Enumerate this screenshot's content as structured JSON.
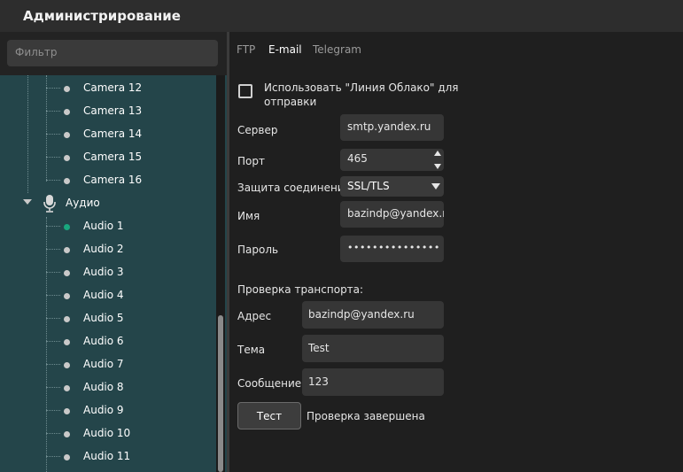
{
  "window": {
    "title": "Администрирование"
  },
  "filter": {
    "placeholder": "Фильтр"
  },
  "tree": {
    "cameras": [
      "Camera 12",
      "Camera 13",
      "Camera 14",
      "Camera 15",
      "Camera 16"
    ],
    "audio_group": "Аудио",
    "audio": [
      "Audio 1",
      "Audio 2",
      "Audio 3",
      "Audio 4",
      "Audio 5",
      "Audio 6",
      "Audio 7",
      "Audio 8",
      "Audio 9",
      "Audio 10",
      "Audio 11"
    ],
    "active_item": "Audio 1",
    "active_color": "#19a77e"
  },
  "tabs": [
    {
      "label": "FTP",
      "active": false
    },
    {
      "label": "E-mail",
      "active": true
    },
    {
      "label": "Telegram",
      "active": false
    }
  ],
  "email": {
    "cloud_checkbox_label": "Использовать \"Линия Облако\" для отправки",
    "cloud_checked": false,
    "server_label": "Сервер",
    "server_value": "smtp.yandex.ru",
    "port_label": "Порт",
    "port_value": "465",
    "security_label": "Защита соединения",
    "security_value": "SSL/TLS",
    "name_label": "Имя",
    "name_value": "bazindp@yandex.ru",
    "password_label": "Пароль",
    "password_value": "•••••••••••••••"
  },
  "transport": {
    "section_title": "Проверка транспорта:",
    "address_label": "Адрес",
    "address_value": "bazindp@yandex.ru",
    "subject_label": "Тема",
    "subject_value": "Test",
    "message_label": "Сообщение",
    "message_value": "123",
    "test_button": "Тест",
    "status": "Проверка завершена"
  }
}
